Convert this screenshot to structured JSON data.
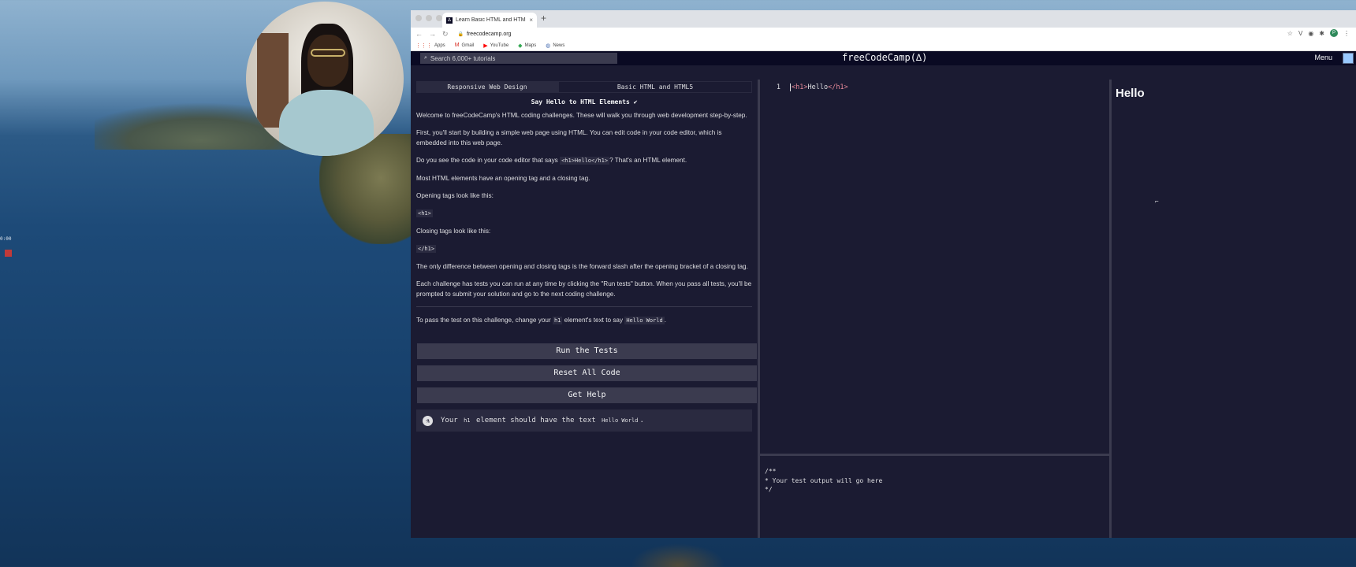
{
  "recorder": {
    "time": "0:00"
  },
  "browser": {
    "tab_title": "Learn Basic HTML and HTML5",
    "url": "freecodecamp.org",
    "bookmarks": [
      {
        "icon": "apps-icon",
        "label": "Apps"
      },
      {
        "icon": "gmail-icon",
        "label": "Gmail"
      },
      {
        "icon": "youtube-icon",
        "label": "YouTube"
      },
      {
        "icon": "maps-icon",
        "label": "Maps"
      },
      {
        "icon": "news-icon",
        "label": "News"
      }
    ]
  },
  "fcc": {
    "search_placeholder": "Search 6,000+ tutorials",
    "logo": "freeCodeCamp(∆)",
    "menu": "Menu"
  },
  "challenge": {
    "breadcrumb_1": "Responsive Web Design",
    "breadcrumb_2": "Basic HTML and HTML5",
    "title": "Say Hello to HTML Elements ✔",
    "p1": "Welcome to freeCodeCamp's HTML coding challenges. These will walk you through web development step-by-step.",
    "p2": "First, you'll start by building a simple web page using HTML. You can edit code in your code editor, which is embedded into this web page.",
    "p3_pre": "Do you see the code in your code editor that says ",
    "p3_code": "<h1>Hello</h1>",
    "p3_post": "? That's an HTML element.",
    "p4": "Most HTML elements have an opening tag and a closing tag.",
    "p5": "Opening tags look like this:",
    "code_open": "<h1>",
    "p6": "Closing tags look like this:",
    "code_close": "</h1>",
    "p7": "The only difference between opening and closing tags is the forward slash after the opening bracket of a closing tag.",
    "p8": "Each challenge has tests you can run at any time by clicking the \"Run tests\" button. When you pass all tests, you'll be prompted to submit your solution and go to the next coding challenge.",
    "instr_pre": "To pass the test on this challenge, change your ",
    "instr_code1": "h1",
    "instr_mid": " element's text to say ",
    "instr_code2": "Hello World",
    "instr_post": "."
  },
  "buttons": {
    "run": "Run the Tests",
    "reset": "Reset All Code",
    "help": "Get Help"
  },
  "test": {
    "pre": "Your ",
    "code1": "h1",
    "mid": " element should have the text ",
    "code2": "Hello World",
    "post": "."
  },
  "editor": {
    "line_number": "1",
    "open_tag": "<h1>",
    "text": "Hello",
    "close_tag": "</h1>"
  },
  "console": {
    "text": "/**\n* Your test output will go here\n*/"
  },
  "preview": {
    "heading": "Hello"
  }
}
